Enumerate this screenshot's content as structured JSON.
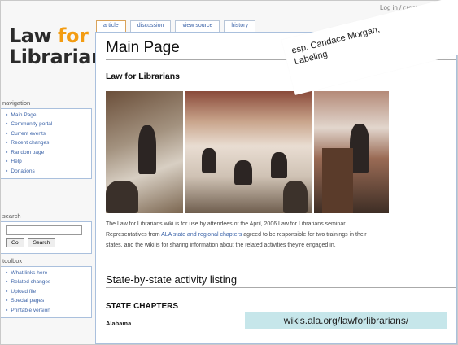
{
  "header": {
    "top_right": "Log in / create account"
  },
  "logo": {
    "line1_a": "Law ",
    "line1_b": "for",
    "line2": "Librarians"
  },
  "tabs": [
    {
      "label": "article"
    },
    {
      "label": "discussion"
    },
    {
      "label": "view source"
    },
    {
      "label": "history"
    }
  ],
  "sidebar": {
    "navigation": {
      "heading": "navigation",
      "items": [
        "Main Page",
        "Community portal",
        "Current events",
        "Recent changes",
        "Random page",
        "Help",
        "Donations"
      ]
    },
    "search": {
      "heading": "search",
      "value": "",
      "go_label": "Go",
      "search_label": "Search"
    },
    "toolbox": {
      "heading": "toolbox",
      "items": [
        "What links here",
        "Related changes",
        "Upload file",
        "Special pages",
        "Printable version"
      ]
    }
  },
  "main": {
    "title": "Main Page",
    "subtitle": "Law for Librarians",
    "paragraph_1": "The Law for Librarians wiki is for use by attendees of the April, 2006 Law for Librarians seminar.",
    "paragraph_2a": "Representatives from ",
    "paragraph_2_link": "ALA state and regional chapters",
    "paragraph_2b": " agreed to be responsible for two trainings in their",
    "paragraph_3": "states, and the wiki is for sharing information about the related activities they're engaged in.",
    "section_heading": "State-by-state activity listing",
    "chapters_heading": "STATE CHAPTERS",
    "first_state": "Alabama"
  },
  "annotations": {
    "note": "esp. Candace Morgan, Labeling",
    "url": "wikis.ala.org/lawforlibrarians/"
  },
  "colors": {
    "link": "#3b63a8",
    "logo_accent": "#f39c12",
    "url_box": "#c6e6ea"
  }
}
